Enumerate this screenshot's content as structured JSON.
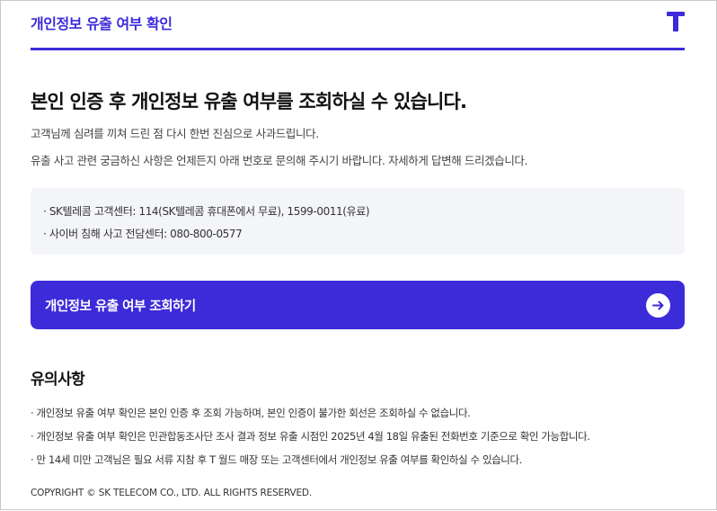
{
  "header": {
    "title": "개인정보 유출 여부 확인",
    "logo_icon": "t-logo-icon"
  },
  "main": {
    "headline": "본인 인증 후 개인정보 유출 여부를 조회하실 수 있습니다.",
    "apology": "고객님께 심려를 끼쳐 드린 점 다시 한번 진심으로 사과드립니다.",
    "contact_note": "유출 사고 관련 궁금하신 사항은 언제든지 아래 번호로 문의해 주시기 바랍니다. 자세하게 답변해 드리겠습니다."
  },
  "contacts": [
    "· SK텔레콤 고객센터: 114(SK텔레콤 휴대폰에서 무료), 1599-0011(유료)",
    "· 사이버 침해 사고 전담센터: 080-800-0577"
  ],
  "cta": {
    "label": "개인정보 유출 여부 조회하기",
    "icon": "arrow-right-circle-icon"
  },
  "notes": {
    "title": "유의사항",
    "items": [
      "· 개인정보 유출 여부 확인은 본인 인증 후 조회 가능하며, 본인 인증이 불가한 회선은 조회하실 수 없습니다.",
      "· 개인정보 유출 여부 확인은 민관합동조사단 조사 결과 정보 유출 시점인 2025년 4월 18일 유출된 전화번호 기준으로 확인 가능합니다.",
      "· 만 14세 미만 고객님은 필요 서류 지참 후 T 월드 매장 또는 고객센터에서 개인정보 유출 여부를 확인하실 수 있습니다."
    ]
  },
  "footer": {
    "copyright": "COPYRIGHT © SK TELECOM CO., LTD. ALL RIGHTS RESERVED."
  },
  "colors": {
    "brand": "#3c2bd9",
    "info_bg": "#f4f5f8"
  }
}
